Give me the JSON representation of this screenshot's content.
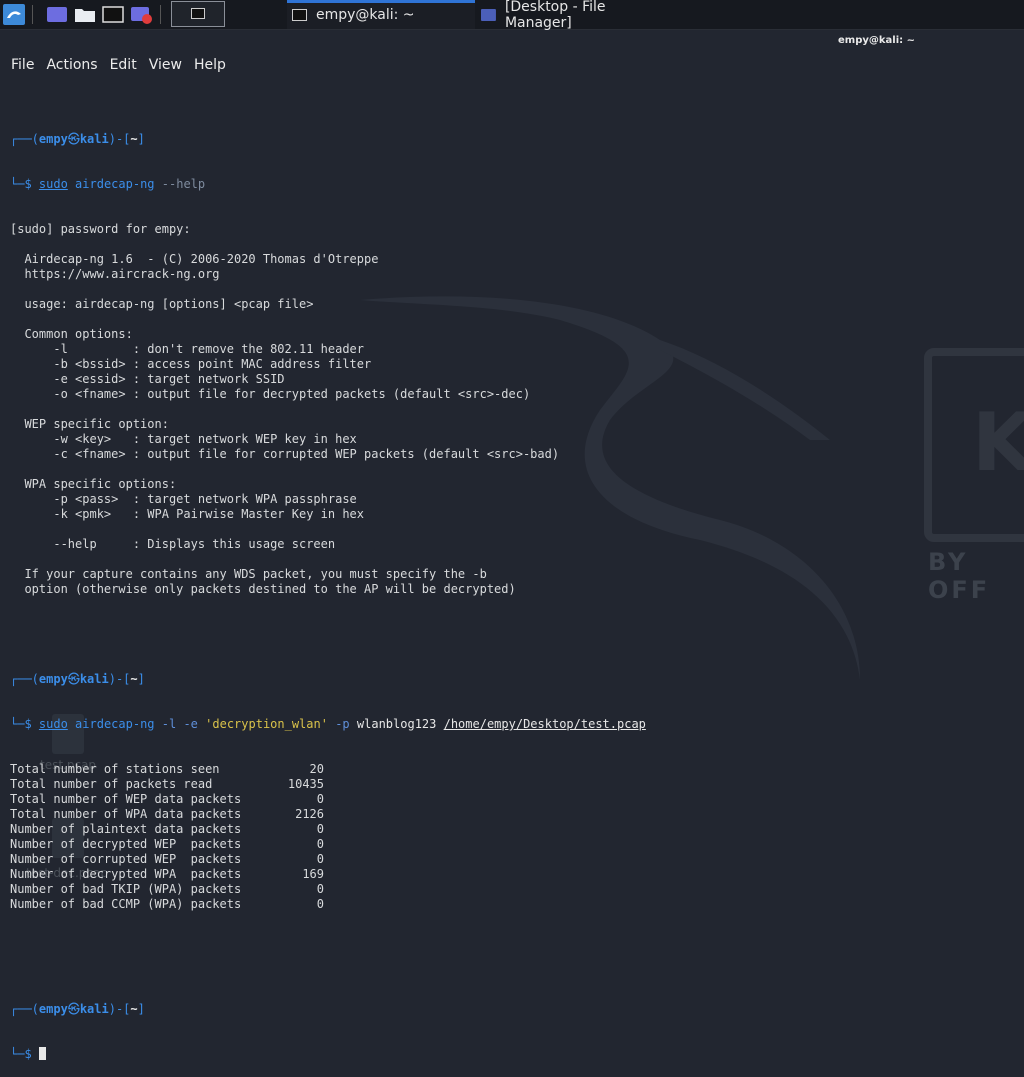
{
  "taskbar": {
    "tasks": [
      {
        "label": "empy@kali: ~"
      },
      {
        "label": "[Desktop - File Manager]"
      }
    ]
  },
  "terminal": {
    "title": "empy@kali: ~",
    "menu": [
      "File",
      "Actions",
      "Edit",
      "View",
      "Help"
    ],
    "prompt": {
      "user": "empy",
      "symbol": "㉿",
      "host": "kali",
      "dir": "~"
    },
    "commands": [
      {
        "sudo": "sudo",
        "prog": "airdecap-ng",
        "args": "--help"
      },
      {
        "sudo": "sudo",
        "prog": "airdecap-ng",
        "opt_l": "-l",
        "opt_e": "-e",
        "essid": "'decryption_wlan'",
        "opt_p": "-p",
        "pass": "wlanblog123",
        "path": "/home/empy/Desktop/test.pcap"
      }
    ],
    "help_lines": [
      "[sudo] password for empy:",
      "",
      "  Airdecap-ng 1.6  - (C) 2006-2020 Thomas d'Otreppe",
      "  https://www.aircrack-ng.org",
      "",
      "  usage: airdecap-ng [options] <pcap file>",
      "",
      "  Common options:",
      "      -l         : don't remove the 802.11 header",
      "      -b <bssid> : access point MAC address filter",
      "      -e <essid> : target network SSID",
      "      -o <fname> : output file for decrypted packets (default <src>-dec)",
      "",
      "  WEP specific option:",
      "      -w <key>   : target network WEP key in hex",
      "      -c <fname> : output file for corrupted WEP packets (default <src>-bad)",
      "",
      "  WPA specific options:",
      "      -p <pass>  : target network WPA passphrase",
      "      -k <pmk>   : WPA Pairwise Master Key in hex",
      "",
      "      --help     : Displays this usage screen",
      "",
      "  If your capture contains any WDS packet, you must specify the -b",
      "  option (otherwise only packets destined to the AP will be decrypted)",
      "",
      ""
    ],
    "stats": [
      {
        "label": "Total number of stations seen",
        "value": "20"
      },
      {
        "label": "Total number of packets read",
        "value": "10435"
      },
      {
        "label": "Total number of WEP data packets",
        "value": "0"
      },
      {
        "label": "Total number of WPA data packets",
        "value": "2126"
      },
      {
        "label": "Number of plaintext data packets",
        "value": "0"
      },
      {
        "label": "Number of decrypted WEP  packets",
        "value": "0"
      },
      {
        "label": "Number of corrupted WEP  packets",
        "value": "0"
      },
      {
        "label": "Number of decrypted WPA  packets",
        "value": "169"
      },
      {
        "label": "Number of bad TKIP (WPA) packets",
        "value": "0"
      },
      {
        "label": "Number of bad CCMP (WPA) packets",
        "value": "0"
      }
    ]
  },
  "desktop": {
    "icons": [
      {
        "label": "test.pcap"
      },
      {
        "label": "test-dec.pcap"
      }
    ],
    "watermark": "BY OFF"
  },
  "colors": {
    "accent": "#3b8eea",
    "background": "#222630",
    "string": "#d9c24a"
  }
}
